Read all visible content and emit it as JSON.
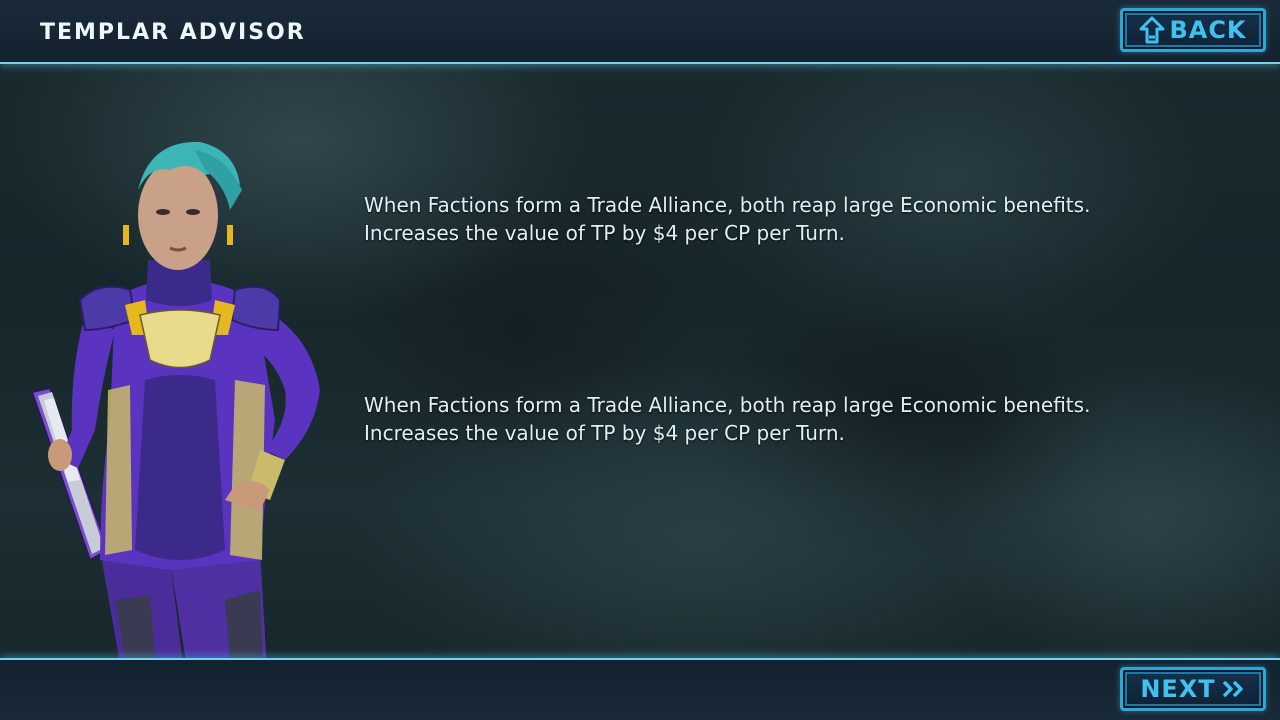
{
  "header": {
    "title": "TEMPLAR ADVISOR",
    "back_label": "BACK",
    "back_icon": "back-arrow-icon"
  },
  "advisor": {
    "portrait": "templar-advisor-portrait"
  },
  "entries": [
    {
      "line1": "When Factions form a Trade Alliance, both reap large Economic benefits.",
      "line2": "Increases the value of TP by $4 per CP per Turn."
    },
    {
      "line1": "When Factions form a Trade Alliance, both reap large Economic benefits.",
      "line2": "Increases the value of TP by $4 per CP per Turn."
    }
  ],
  "footer": {
    "next_label": "NEXT",
    "next_icon": "double-chevron-right-icon"
  },
  "colors": {
    "accent": "#6fd6ee",
    "button_text": "#3fc2f0",
    "title_text": "#eef6fa",
    "body_text": "#dff0f4"
  }
}
